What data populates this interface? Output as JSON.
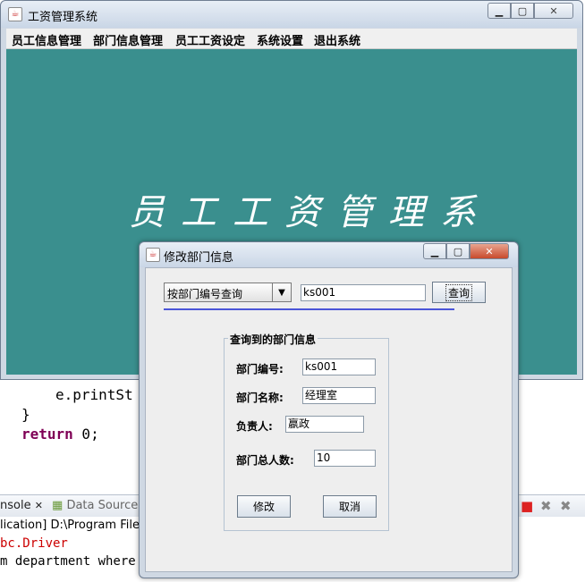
{
  "ide": {
    "code_lines": [
      {
        "text": "e.printSt",
        "keyword": ""
      },
      {
        "text": "}",
        "keyword": ""
      },
      {
        "text": " 0;",
        "keyword": "return"
      }
    ],
    "tabs": [
      {
        "label": "nsole",
        "icon": "x-close-icon"
      },
      {
        "label": "Data Source",
        "icon": "database-icon"
      }
    ],
    "console_lines": [
      {
        "text": "lication] D:\\Program Files\\",
        "color": "#000000"
      },
      {
        "text": "bc.Driver",
        "color": "#cc0000"
      },
      {
        "text": "m department where",
        "color": "#000000"
      }
    ]
  },
  "main_window": {
    "title": "工资管理系统",
    "menu": [
      "员工信息管理",
      "部门信息管理",
      "员工工资设定",
      "系统设置",
      "退出系统"
    ],
    "banner": "员工工资管理系统",
    "background_color": "#3a8f8e"
  },
  "dialog": {
    "title": "修改部门信息",
    "search_mode": "按部门编号查询",
    "search_value": "ks001",
    "query_button": "查询",
    "group_title": "查询到的部门信息",
    "fields": [
      {
        "label": "部门编号:",
        "value": "ks001"
      },
      {
        "label": "部门名称:",
        "value": "经理室"
      },
      {
        "label": "负责人:",
        "value": "嬴政"
      },
      {
        "label": "部门总人数:",
        "value": "10"
      }
    ],
    "modify_button": "修改",
    "cancel_button": "取消"
  }
}
